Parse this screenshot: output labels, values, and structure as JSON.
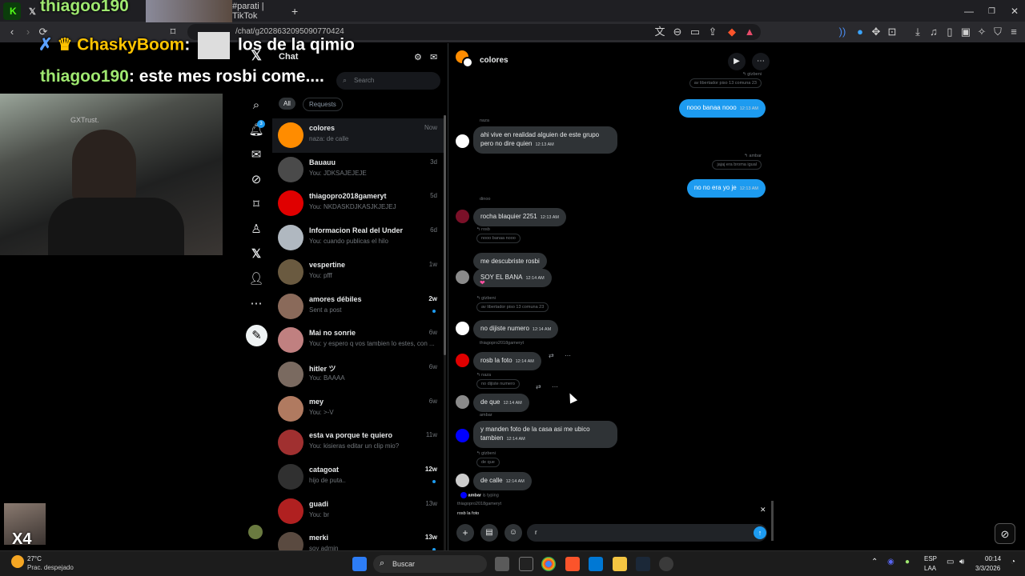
{
  "browser": {
    "tab_title": "#parati | TikTok",
    "url": "/chat/g2028632095090770424"
  },
  "stream_overlay": {
    "lines": [
      {
        "nick": "thiagoo190",
        "sep": "",
        "text": ""
      },
      {
        "nick": "ChaskyBoom",
        "sep": ":",
        "text": "los de la qimio"
      },
      {
        "nick": "thiagoo190",
        "sep": ":",
        "text": "este mes rosbi come...."
      }
    ],
    "cam_label": "GXTrust.",
    "x4_label": "X4"
  },
  "sidebar_nav": {
    "notifications_badge": "3",
    "icons": [
      "x-logo-icon",
      "search-icon",
      "bell-icon",
      "mail-icon",
      "grok-icon",
      "bookmark-icon",
      "people-icon",
      "x-premium-icon",
      "profile-icon",
      "more-icon",
      "compose-icon"
    ]
  },
  "chat_panel": {
    "title": "Chat",
    "search_placeholder": "Search",
    "filter_all": "All",
    "filter_requests": "Requests",
    "conversations": [
      {
        "name": "colores",
        "preview": "naza: de calle",
        "time": "Now",
        "unread": false,
        "color": "#ff8c00"
      },
      {
        "name": "Bauauu",
        "preview": "You: JDKSAJEJEJE",
        "time": "3d",
        "unread": false,
        "color": "#4a4a4a"
      },
      {
        "name": "thiagopro2018gameryt",
        "preview": "You: NKDASKDJKASJKJEJEJ",
        "time": "5d",
        "unread": false,
        "color": "#e00000"
      },
      {
        "name": "Informacion Real del Under",
        "preview": "You: cuando publicas el hilo",
        "time": "6d",
        "unread": false,
        "color": "#b0b8c0"
      },
      {
        "name": "vespertine",
        "preview": "You: pfff",
        "time": "1w",
        "unread": false,
        "color": "#6a5a40"
      },
      {
        "name": "amores débiles",
        "preview": "Sent a post",
        "time": "2w",
        "unread": true,
        "color": "#8a6a5a"
      },
      {
        "name": "Mai no sonrie",
        "preview": "You: y espero q vos tambien lo estes, con ...",
        "time": "6w",
        "unread": false,
        "color": "#c08080"
      },
      {
        "name": "hitler ツ",
        "preview": "You: BAAAA",
        "time": "6w",
        "unread": false,
        "color": "#7a6a60"
      },
      {
        "name": "mey",
        "preview": "You: >-V",
        "time": "6w",
        "unread": false,
        "color": "#b07a60"
      },
      {
        "name": "esta va porque te quiero",
        "preview": "You: kisieras editar un clip mio?",
        "time": "11w",
        "unread": false,
        "color": "#a03030"
      },
      {
        "name": "catagoat",
        "preview": "hijo de puta..",
        "time": "12w",
        "unread": true,
        "color": "#303030"
      },
      {
        "name": "guadi",
        "preview": "You: br",
        "time": "13w",
        "unread": false,
        "color": "#b02020"
      },
      {
        "name": "merki",
        "preview": "soy admin",
        "time": "13w",
        "unread": true,
        "color": "#5a4a40"
      }
    ]
  },
  "conversation": {
    "title": "colores",
    "messages": [
      {
        "kind": "reply-ref",
        "from": "gtzbeni",
        "ref": "av libertador piso 13 comuna 23"
      },
      {
        "kind": "me",
        "text": "nooo banaa nooo",
        "time": "12:13 AM"
      },
      {
        "kind": "label",
        "text": "naza"
      },
      {
        "kind": "them",
        "text": "ahi vive en realidad alguien de este grupo pero no dire quien",
        "time": "12:13 AM"
      },
      {
        "kind": "reply-ref",
        "from": "ambar",
        "ref": "jajaj era broma igual"
      },
      {
        "kind": "me",
        "text": "no no era yo je",
        "time": "12:13 AM"
      },
      {
        "kind": "label",
        "text": "dinoo"
      },
      {
        "kind": "them",
        "text": "rocha blaquier 2251",
        "time": "12:13 AM"
      },
      {
        "kind": "reply-ref",
        "from": "rosb",
        "ref": "nooo banaa nooo"
      },
      {
        "kind": "them",
        "text": "me descubriste rosbi",
        "time": ""
      },
      {
        "kind": "them",
        "text": "SOY EL BANA",
        "time": "12:14 AM"
      },
      {
        "kind": "reply-ref",
        "from": "gtzbeni",
        "ref": "av libertador piso 13 comuna 23"
      },
      {
        "kind": "them",
        "text": "no dijiste numero",
        "time": "12:14 AM"
      },
      {
        "kind": "label",
        "text": "thiagopro2018gameryt"
      },
      {
        "kind": "them",
        "text": "rosb la foto",
        "time": "12:14 AM"
      },
      {
        "kind": "reply-ref",
        "from": "naza",
        "ref": "no dijiste numero"
      },
      {
        "kind": "them",
        "text": "de que",
        "time": "12:14 AM"
      },
      {
        "kind": "label",
        "text": "ambar"
      },
      {
        "kind": "them",
        "text": "y manden foto de la casa asi me ubico tambien",
        "time": "12:14 AM"
      },
      {
        "kind": "reply-ref",
        "from": "gtzbeni",
        "ref": "de que"
      },
      {
        "kind": "them",
        "text": "de calle",
        "time": "12:14 AM"
      }
    ],
    "typing": {
      "name": "ambar",
      "text": "is typing"
    },
    "replying_to": {
      "name": "thiagopro2018gameryt",
      "text": "rosb la foto"
    },
    "composer_value": "r"
  },
  "taskbar": {
    "weather_temp": "27°C",
    "weather_desc": "Prac. despejado",
    "search_label": "Buscar",
    "lang_top": "ESP",
    "lang_bottom": "LAA",
    "clock_time": "00:14",
    "clock_date": "3/3/2026"
  }
}
